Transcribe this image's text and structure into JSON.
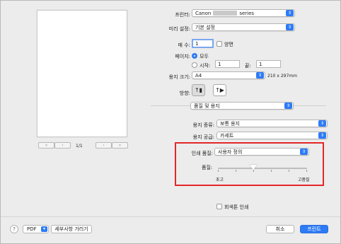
{
  "preview": {
    "page_indicator": "1/1"
  },
  "printer": {
    "label": "프린터:",
    "value_prefix": "Canon",
    "value_suffix": "series"
  },
  "presets": {
    "label": "미리 설정:",
    "value": "기본 설정"
  },
  "copies": {
    "label": "매 수:",
    "value": "1",
    "duplex_label": "양면"
  },
  "pages": {
    "label": "페이지:",
    "all_label": "모두",
    "from_label": "시작:",
    "from_value": "1",
    "to_label": "끝:",
    "to_value": "1"
  },
  "paper_size": {
    "label": "용지 크기:",
    "value": "A4",
    "dimensions": "210 x 297mm"
  },
  "orientation": {
    "label": "방향:"
  },
  "section": {
    "value": "품질 및 용지"
  },
  "media_type": {
    "label": "용지 종류:",
    "value": "보통 용지"
  },
  "paper_source": {
    "label": "용지 공급:",
    "value": "카세트"
  },
  "print_quality": {
    "label": "인쇄 품질:",
    "value": "사용자 정의"
  },
  "quality": {
    "label": "품질:",
    "min_label": "초고",
    "max_label": "고품질",
    "level": 0.4
  },
  "grayscale": {
    "label": "회색톤 인쇄"
  },
  "footer": {
    "help_label": "?",
    "pdf_label": "PDF",
    "pdf_arrow": "▾",
    "hide_details_label": "세부사항 가리기",
    "cancel_label": "취소",
    "print_label": "프린트"
  },
  "colors": {
    "accent": "#2e7bf6",
    "highlight_box": "#e3262a"
  }
}
